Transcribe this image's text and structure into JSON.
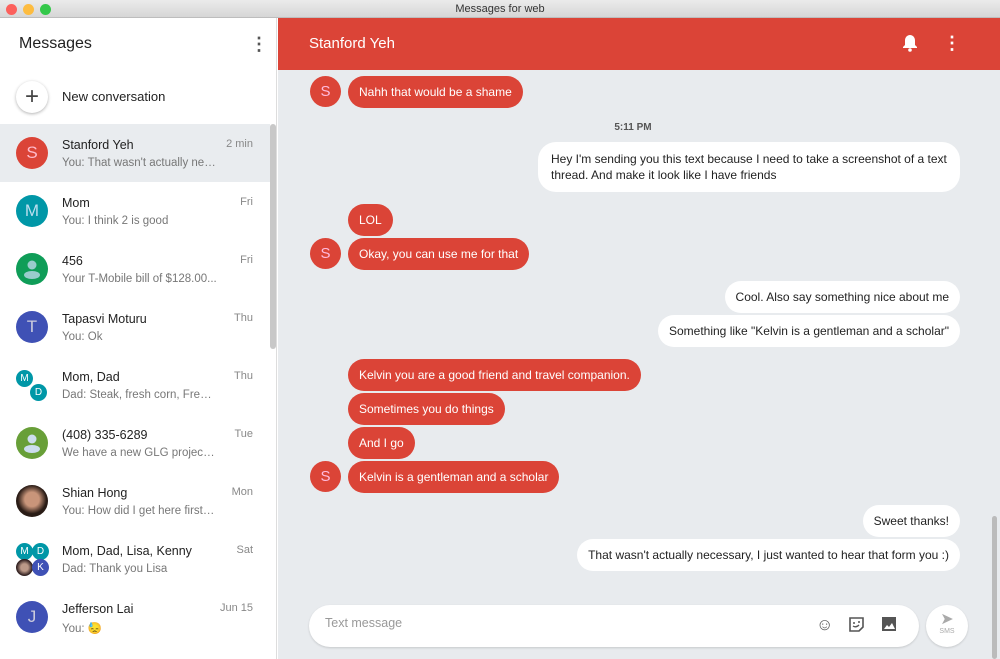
{
  "window": {
    "title": "Messages for web"
  },
  "sidebar": {
    "title": "Messages",
    "new_conversation": "New conversation",
    "conversations": [
      {
        "name": "Stanford Yeh",
        "preview": "You: That wasn't actually nec...",
        "time": "2 min",
        "initial": "S",
        "color": "#db4437",
        "active": true
      },
      {
        "name": "Mom",
        "preview": "You: I think 2 is good",
        "time": "Fri",
        "initial": "M",
        "color": "#0097a7"
      },
      {
        "name": "456",
        "preview": "Your T-Mobile bill of $128.00...",
        "time": "Fri",
        "initial": "",
        "color": "#0f9d58"
      },
      {
        "name": "Tapasvi Moturu",
        "preview": "You: Ok",
        "time": "Thu",
        "initial": "T",
        "color": "#3f51b5"
      },
      {
        "name": "Mom, Dad",
        "preview": "Dad: Steak, fresh corn, Frenc...",
        "time": "Thu",
        "initials": [
          "M",
          "D"
        ],
        "color": "#0097a7"
      },
      {
        "name": "(408) 335-6289",
        "preview": "We have a new GLG project ...",
        "time": "Tue",
        "initial": "",
        "color": "#689f38"
      },
      {
        "name": "Shian Hong",
        "preview": "You: How did I get here first l...",
        "time": "Mon",
        "initial": "",
        "color": "#5d4037"
      },
      {
        "name": "Mom, Dad, Lisa, Kenny",
        "preview": "Dad: Thank you Lisa",
        "time": "Sat",
        "initials": [
          "M",
          "D",
          "",
          "K"
        ],
        "color": "#0097a7"
      },
      {
        "name": "Jefferson Lai",
        "preview": "You: 😓",
        "time": "Jun 15",
        "initial": "J",
        "color": "#3f51b5"
      }
    ]
  },
  "header": {
    "title": "Stanford Yeh",
    "accent": "#db4437"
  },
  "thread": {
    "contact_initial": "S",
    "timestamp": "5:11 PM",
    "messages": [
      {
        "dir": "in",
        "text": "Nahh that would be a shame"
      },
      {
        "dir": "out",
        "text": "Hey I'm sending you this text because I need to take a screenshot of a text thread. And make it look like I have friends"
      },
      {
        "dir": "in",
        "text": "LOL"
      },
      {
        "dir": "in",
        "text": "Okay, you can use me for that"
      },
      {
        "dir": "out",
        "text": "Cool. Also say something nice about me"
      },
      {
        "dir": "out",
        "text": "Something like \"Kelvin is a gentleman and a scholar\""
      },
      {
        "dir": "in",
        "text": "Kelvin you are a good friend and travel companion."
      },
      {
        "dir": "in",
        "text": "Sometimes you do things"
      },
      {
        "dir": "in",
        "text": "And I go"
      },
      {
        "dir": "in",
        "text": "Kelvin is a gentleman and a scholar"
      },
      {
        "dir": "out",
        "text": "Sweet thanks!"
      },
      {
        "dir": "out",
        "text": "That wasn't actually necessary, I just wanted to hear that form you :)"
      }
    ]
  },
  "composer": {
    "placeholder": "Text message",
    "send_label": "SMS"
  }
}
